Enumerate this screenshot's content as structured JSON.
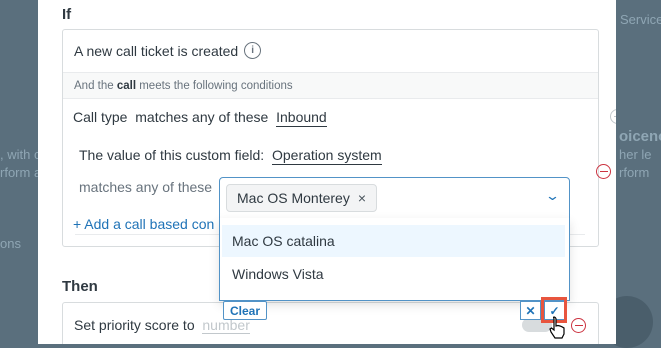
{
  "background": {
    "top_right_text": "Service",
    "heading_fragment": "oiceno",
    "text_fragments": [
      ", with c",
      "rform ac",
      "ons",
      "her le",
      "rform"
    ]
  },
  "if_section": {
    "title": "If",
    "trigger_label": "A new call ticket is created",
    "info_icon": "info-circle-icon",
    "conditions_intro_prefix": "And the ",
    "conditions_intro_bold": "call",
    "conditions_intro_suffix": " meets the following conditions",
    "condition1": {
      "field": "Call type",
      "operator": "matches any of these",
      "value": "Inbound"
    },
    "condition2": {
      "field_label": "The value of this custom field:",
      "field_value": "Operation system",
      "operator": "matches any of these"
    },
    "add_condition_label": "+ Add a call based con"
  },
  "dropdown": {
    "selected_tag": "Mac OS Monterey",
    "remove_icon": "×",
    "chevron_icon": "chevron-down-icon",
    "options": [
      "Mac OS catalina",
      "Windows Vista"
    ],
    "highlighted_index": 0,
    "clear_label": "Clear",
    "cancel_symbol": "✕",
    "confirm_symbol": "✓"
  },
  "then_section": {
    "title": "Then",
    "action_label": "Set priority score to",
    "action_placeholder": "number"
  },
  "colors": {
    "accent": "#1f73b7",
    "danger": "#cc3340",
    "focus": "#e8553e"
  }
}
